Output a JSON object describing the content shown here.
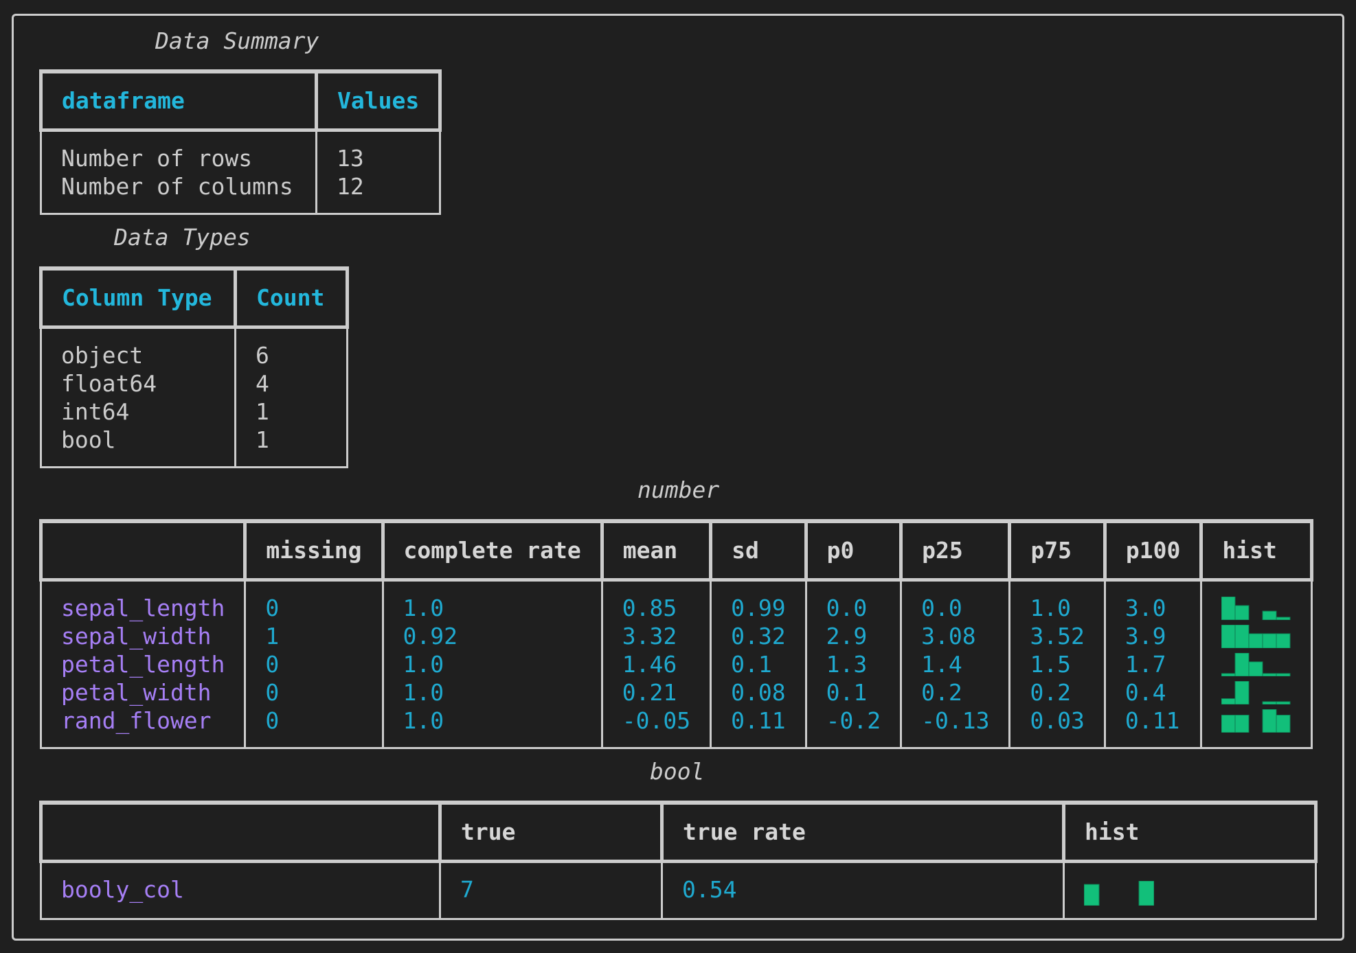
{
  "colors": {
    "background": "#1f1f1f",
    "border": "#cccccc",
    "header_accent": "#23b7dc",
    "row_name": "#a67ff5",
    "value": "#1fa9cf",
    "hist_bar": "#12bf7a"
  },
  "data_summary": {
    "title": "Data Summary",
    "headers": [
      "dataframe",
      "Values"
    ],
    "rows": [
      {
        "label": "Number of rows",
        "value": "13"
      },
      {
        "label": "Number of columns",
        "value": "12"
      }
    ]
  },
  "data_types": {
    "title": "Data Types",
    "headers": [
      "Column Type",
      "Count"
    ],
    "rows": [
      {
        "type": "object",
        "count": "6"
      },
      {
        "type": "float64",
        "count": "4"
      },
      {
        "type": "int64",
        "count": "1"
      },
      {
        "type": "bool",
        "count": "1"
      }
    ]
  },
  "number": {
    "title": "number",
    "headers": [
      "",
      "missing",
      "complete rate",
      "mean",
      "sd",
      "p0",
      "p25",
      "p75",
      "p100",
      "hist"
    ],
    "rows": [
      {
        "name": "sepal_length",
        "missing": "0",
        "complete_rate": "1.0",
        "mean": "0.85",
        "sd": "0.99",
        "p0": "0.0",
        "p25": "0.0",
        "p75": "1.0",
        "p100": "3.0",
        "hist": [
          1.0,
          0.62,
          0,
          0.38,
          0.12
        ]
      },
      {
        "name": "sepal_width",
        "missing": "1",
        "complete_rate": "0.92",
        "mean": "3.32",
        "sd": "0.32",
        "p0": "2.9",
        "p25": "3.08",
        "p75": "3.52",
        "p100": "3.9",
        "hist": [
          1.0,
          1.0,
          0.62,
          0.62,
          0.62
        ]
      },
      {
        "name": "petal_length",
        "missing": "0",
        "complete_rate": "1.0",
        "mean": "1.46",
        "sd": "0.1",
        "p0": "1.3",
        "p25": "1.4",
        "p75": "1.5",
        "p100": "1.7",
        "hist": [
          0.12,
          1.0,
          0.62,
          0.12,
          0.12
        ]
      },
      {
        "name": "petal_width",
        "missing": "0",
        "complete_rate": "1.0",
        "mean": "0.21",
        "sd": "0.08",
        "p0": "0.1",
        "p25": "0.2",
        "p75": "0.2",
        "p100": "0.4",
        "hist": [
          0.25,
          1.0,
          0,
          0.12,
          0.12
        ]
      },
      {
        "name": "rand_flower",
        "missing": "0",
        "complete_rate": "1.0",
        "mean": "-0.05",
        "sd": "0.11",
        "p0": "-0.2",
        "p25": "-0.13",
        "p75": "0.03",
        "p100": "0.11",
        "hist": [
          0.75,
          0.75,
          0,
          1.0,
          0.75
        ]
      }
    ]
  },
  "bool": {
    "title": "bool",
    "headers": [
      "",
      "true",
      "true rate",
      "hist"
    ],
    "rows": [
      {
        "name": "booly_col",
        "true": "7",
        "true_rate": "0.54",
        "hist": [
          0.86,
          1.0
        ]
      }
    ]
  }
}
